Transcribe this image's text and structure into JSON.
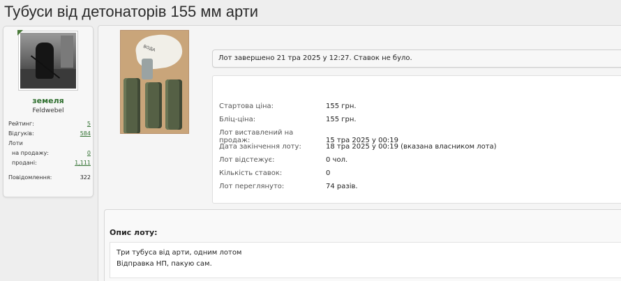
{
  "page": {
    "title": "Тубуси від детонаторів 155 мм арти"
  },
  "user": {
    "name": "земеля",
    "rank": "Feldwebel",
    "stats": {
      "rating_label": "Рейтинг:",
      "rating_value": "5",
      "feedback_label": "Відгуків:",
      "feedback_value": "584",
      "lots_label": "Лоти",
      "for_sale_label": "на продажу:",
      "for_sale_value": "0",
      "sold_label": "продані:",
      "sold_value": "1,111",
      "messages_label": "Повідомлення:",
      "messages_value": "322"
    }
  },
  "photo": {
    "bag_text": "ВОДА"
  },
  "lot": {
    "status": "Лот завершено 21 тра 2025 у 12:27. Ставок не було.",
    "details": [
      {
        "label": "Стартова ціна:",
        "value": "155 грн."
      },
      {
        "label": "Бліц-ціна:",
        "value": "155 грн."
      },
      {
        "label": "Лот виставлений на продаж:",
        "value": "15 тра 2025 у 00:19"
      },
      {
        "label": "Дата закінчення лоту:",
        "value": "18 тра 2025 у 00:19 (вказана власником лота)"
      },
      {
        "label": "Лот відстежує:",
        "value": "0 чол."
      },
      {
        "label": "Кількість ставок:",
        "value": "0"
      },
      {
        "label": "Лот переглянуто:",
        "value": "74 разів."
      }
    ]
  },
  "description": {
    "heading": "Опис лоту:",
    "lines": [
      "Три тубуса від арти, одним лотом",
      "Відправка НП, пакую сам."
    ]
  }
}
